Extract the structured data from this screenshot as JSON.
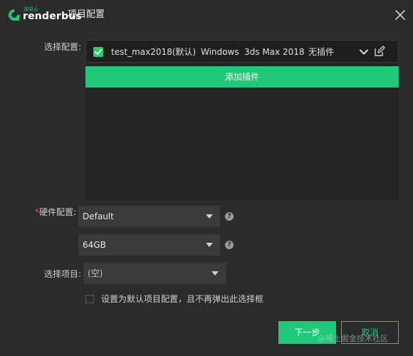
{
  "app": {
    "brand_cn": "渲染云",
    "brand_en": "renderbus",
    "title": "项目配置"
  },
  "colors": {
    "accent": "#1fc978",
    "background": "#2b2b2b",
    "required": "#e74c3c"
  },
  "config": {
    "label": "选择配置:",
    "item": {
      "checked": true,
      "name": "test_max2018(默认)",
      "os": "Windows",
      "software": "3ds Max 2018",
      "plugins": "无插件"
    },
    "add_plugin_label": "添加插件"
  },
  "hardware": {
    "required_mark": "*",
    "label": "硬件配置:",
    "machine": "Default",
    "memory": "64GB"
  },
  "project": {
    "label": "选择项目:",
    "value": "(空)"
  },
  "default_option": {
    "checked": false,
    "text": "设置为默认项目配置，且不再弹出此选择框"
  },
  "footer": {
    "next_label": "下一步",
    "cancel_label": "取消",
    "watermark": "@稀土掘金技术社区"
  },
  "icons": {
    "close": "close-icon",
    "dropdown": "chevron-down-icon",
    "edit": "edit-icon",
    "help": "help-icon"
  }
}
